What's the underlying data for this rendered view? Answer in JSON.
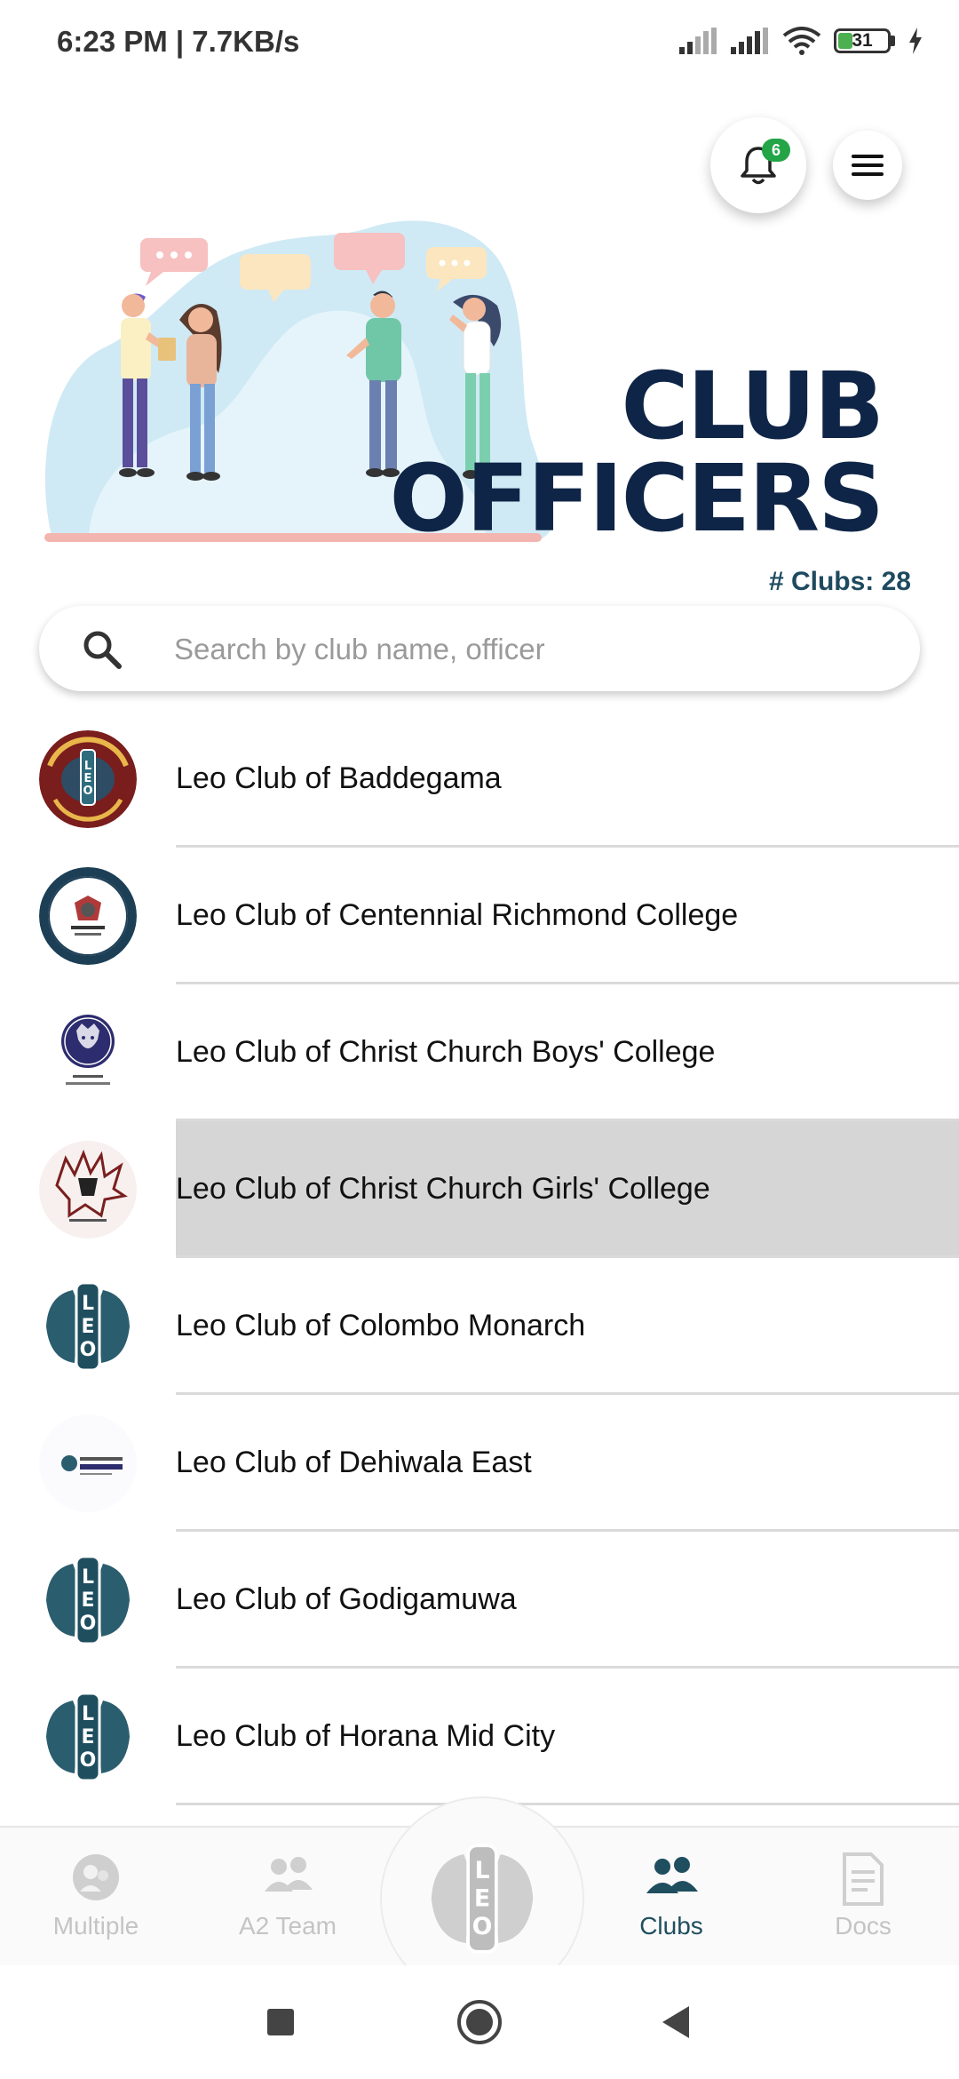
{
  "status_bar": {
    "time": "6:23 PM | 7.7KB/s",
    "battery": "31"
  },
  "header": {
    "notification_count": "6"
  },
  "hero": {
    "title_line1": "CLUB",
    "title_line2": "OFFICERS"
  },
  "clubs_count": "# Clubs: 28",
  "search": {
    "placeholder": "Search by club name, officer",
    "value": ""
  },
  "clubs": [
    {
      "name": "Leo Club of Baddegama",
      "logo": "baddegama-logo"
    },
    {
      "name": "Leo Club of Centennial Richmond College",
      "logo": "richmond-logo"
    },
    {
      "name": "Leo Club of Christ Church Boys' College",
      "logo": "boys-college-logo"
    },
    {
      "name": "Leo Club of Christ Church Girls' College",
      "logo": "girls-college-logo"
    },
    {
      "name": "Leo Club of Colombo Monarch",
      "logo": "leo-logo"
    },
    {
      "name": "Leo Club of Dehiwala East",
      "logo": "dehiwala-logo"
    },
    {
      "name": "Leo Club of Godigamuwa",
      "logo": "leo-logo"
    },
    {
      "name": "Leo Club of Horana Mid City",
      "logo": "leo-logo"
    }
  ],
  "bottom_nav": {
    "items": [
      {
        "label": "Multiple",
        "icon": "multiple-icon"
      },
      {
        "label": "A2 Team",
        "icon": "team-icon"
      },
      {
        "label": "Clubs",
        "icon": "clubs-icon",
        "active": true
      },
      {
        "label": "Docs",
        "icon": "docs-icon"
      }
    ],
    "center_icon": "leo-center-logo"
  },
  "colors": {
    "brand_dark": "#0f2547",
    "accent_teal": "#1f4e5f",
    "badge_green": "#22a447"
  }
}
